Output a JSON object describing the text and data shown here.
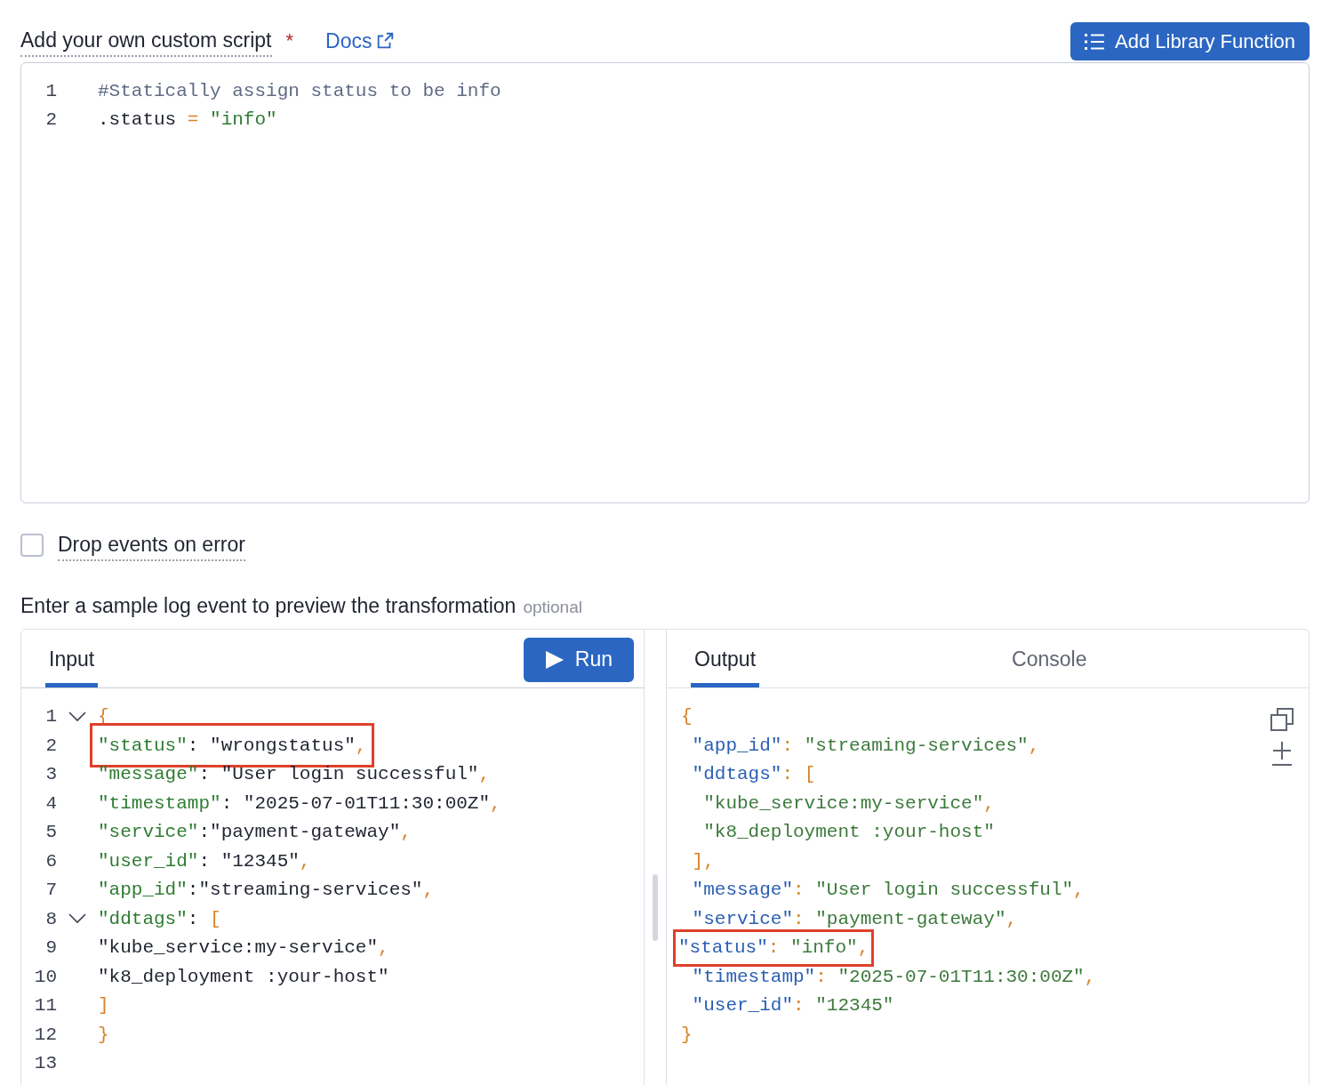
{
  "script_section": {
    "label": "Add your own custom script",
    "required_mark": "*",
    "docs_link": "Docs",
    "add_button": "Add Library Function",
    "lines": [
      {
        "number": "1",
        "tokens": [
          {
            "kind": "comment",
            "t": "#Statically assign status to be info"
          }
        ]
      },
      {
        "number": "2",
        "tokens": [
          {
            "kind": "plain",
            "t": ".status "
          },
          {
            "kind": "op",
            "t": "= "
          },
          {
            "kind": "string",
            "t": "\"info\""
          }
        ]
      }
    ]
  },
  "drop_events": {
    "label": "Drop events on error",
    "checked": false
  },
  "preview": {
    "label": "Enter a sample log event to preview the transformation",
    "hint": "optional",
    "input": {
      "tabs": [
        {
          "label": "Input",
          "selected": true
        }
      ],
      "run_button": "Run",
      "lines": [
        {
          "number": "1",
          "foldable": true,
          "highlighted": false,
          "tokens": [
            {
              "kind": "punct",
              "t": "{"
            }
          ]
        },
        {
          "number": "2",
          "foldable": false,
          "highlighted": true,
          "tokens": [
            {
              "kind": "key",
              "t": "\"status\""
            },
            {
              "kind": "plain",
              "t": ": \"wrongstatus\""
            },
            {
              "kind": "punct",
              "t": ","
            }
          ]
        },
        {
          "number": "3",
          "foldable": false,
          "highlighted": false,
          "tokens": [
            {
              "kind": "key",
              "t": "\"message\""
            },
            {
              "kind": "plain",
              "t": ": \"User login successful\""
            },
            {
              "kind": "punct",
              "t": ","
            }
          ]
        },
        {
          "number": "4",
          "foldable": false,
          "highlighted": false,
          "tokens": [
            {
              "kind": "key",
              "t": "\"timestamp\""
            },
            {
              "kind": "plain",
              "t": ": \"2025-07-01T11:30:00Z\""
            },
            {
              "kind": "punct",
              "t": ","
            }
          ]
        },
        {
          "number": "5",
          "foldable": false,
          "highlighted": false,
          "tokens": [
            {
              "kind": "key",
              "t": "\"service\""
            },
            {
              "kind": "plain",
              "t": ":\"payment-gateway\""
            },
            {
              "kind": "punct",
              "t": ","
            }
          ]
        },
        {
          "number": "6",
          "foldable": false,
          "highlighted": false,
          "tokens": [
            {
              "kind": "key",
              "t": "\"user_id\""
            },
            {
              "kind": "plain",
              "t": ": \"12345\""
            },
            {
              "kind": "punct",
              "t": ","
            }
          ]
        },
        {
          "number": "7",
          "foldable": false,
          "highlighted": false,
          "tokens": [
            {
              "kind": "key",
              "t": "\"app_id\""
            },
            {
              "kind": "plain",
              "t": ":\"streaming-services\""
            },
            {
              "kind": "punct",
              "t": ","
            }
          ]
        },
        {
          "number": "8",
          "foldable": true,
          "highlighted": false,
          "tokens": [
            {
              "kind": "key",
              "t": "\"ddtags\""
            },
            {
              "kind": "plain",
              "t": ": "
            },
            {
              "kind": "punct",
              "t": "["
            }
          ]
        },
        {
          "number": "9",
          "foldable": false,
          "highlighted": false,
          "tokens": [
            {
              "kind": "plain",
              "t": "\"kube_service:my-service\""
            },
            {
              "kind": "punct",
              "t": ","
            }
          ]
        },
        {
          "number": "10",
          "foldable": false,
          "highlighted": false,
          "tokens": [
            {
              "kind": "plain",
              "t": "\"k8_deployment :your-host\""
            }
          ]
        },
        {
          "number": "11",
          "foldable": false,
          "highlighted": false,
          "tokens": [
            {
              "kind": "punct",
              "t": "]"
            }
          ]
        },
        {
          "number": "12",
          "foldable": false,
          "highlighted": false,
          "tokens": [
            {
              "kind": "punct",
              "t": "}"
            }
          ]
        },
        {
          "number": "13",
          "foldable": false
        }
      ]
    },
    "output": {
      "tabs": [
        {
          "label": "Output",
          "selected": true
        },
        {
          "label": "Console",
          "selected": false
        }
      ],
      "lines": [
        {
          "highlighted": false,
          "tokens": [
            {
              "kind": "punct",
              "t": "{"
            }
          ]
        },
        {
          "highlighted": false,
          "tokens": [
            {
              "kind": "key",
              "t": " \"app_id\""
            },
            {
              "kind": "punct",
              "t": ": "
            },
            {
              "kind": "string",
              "t": "\"streaming-services\""
            },
            {
              "kind": "punct",
              "t": ","
            }
          ]
        },
        {
          "highlighted": false,
          "tokens": [
            {
              "kind": "key",
              "t": " \"ddtags\""
            },
            {
              "kind": "punct",
              "t": ": ["
            }
          ]
        },
        {
          "highlighted": false,
          "tokens": [
            {
              "kind": "string",
              "t": "  \"kube_service:my-service\""
            },
            {
              "kind": "punct",
              "t": ","
            }
          ]
        },
        {
          "highlighted": false,
          "tokens": [
            {
              "kind": "string",
              "t": "  \"k8_deployment :your-host\""
            }
          ]
        },
        {
          "highlighted": false,
          "tokens": [
            {
              "kind": "punct",
              "t": " ],"
            }
          ]
        },
        {
          "highlighted": false,
          "tokens": [
            {
              "kind": "key",
              "t": " \"message\""
            },
            {
              "kind": "punct",
              "t": ": "
            },
            {
              "kind": "string",
              "t": "\"User login successful\""
            },
            {
              "kind": "punct",
              "t": ","
            }
          ]
        },
        {
          "highlighted": false,
          "tokens": [
            {
              "kind": "key",
              "t": " \"service\""
            },
            {
              "kind": "punct",
              "t": ": "
            },
            {
              "kind": "string",
              "t": "\"payment-gateway\""
            },
            {
              "kind": "punct",
              "t": ","
            }
          ]
        },
        {
          "highlighted": true,
          "tokens": [
            {
              "kind": "key",
              "t": "\"status\""
            },
            {
              "kind": "punct",
              "t": ": "
            },
            {
              "kind": "string",
              "t": "\"info\""
            },
            {
              "kind": "punct",
              "t": ","
            }
          ]
        },
        {
          "highlighted": false,
          "tokens": [
            {
              "kind": "key",
              "t": " \"timestamp\""
            },
            {
              "kind": "punct",
              "t": ": "
            },
            {
              "kind": "string",
              "t": "\"2025-07-01T11:30:00Z\""
            },
            {
              "kind": "punct",
              "t": ","
            }
          ]
        },
        {
          "highlighted": false,
          "tokens": [
            {
              "kind": "key",
              "t": " \"user_id\""
            },
            {
              "kind": "punct",
              "t": ": "
            },
            {
              "kind": "string",
              "t": "\"12345\""
            }
          ]
        },
        {
          "highlighted": false,
          "tokens": [
            {
              "kind": "punct",
              "t": "}"
            }
          ]
        }
      ]
    }
  }
}
